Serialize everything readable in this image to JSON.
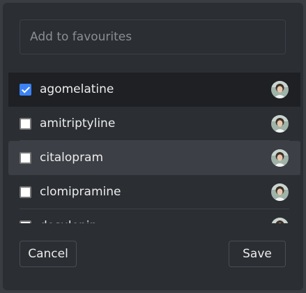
{
  "search": {
    "placeholder": "Add to favourites",
    "value": ""
  },
  "items": [
    {
      "label": "agomelatine",
      "checked": true,
      "state": "selected",
      "avatar": "avatar-icon"
    },
    {
      "label": "amitriptyline",
      "checked": false,
      "state": "normal",
      "avatar": "avatar-icon"
    },
    {
      "label": "citalopram",
      "checked": false,
      "state": "hover",
      "avatar": "avatar-icon"
    },
    {
      "label": "clomipramine",
      "checked": false,
      "state": "normal",
      "avatar": "avatar-icon"
    },
    {
      "label": "dosulepin",
      "checked": false,
      "state": "normal",
      "avatar": "avatar-icon"
    }
  ],
  "footer": {
    "cancel_label": "Cancel",
    "save_label": "Save"
  },
  "colors": {
    "dialog_bg": "#2b2e33",
    "selected_row_bg": "#1e2024",
    "hover_row_bg": "#3c3f45",
    "checkbox_checked": "#3b82f6"
  }
}
